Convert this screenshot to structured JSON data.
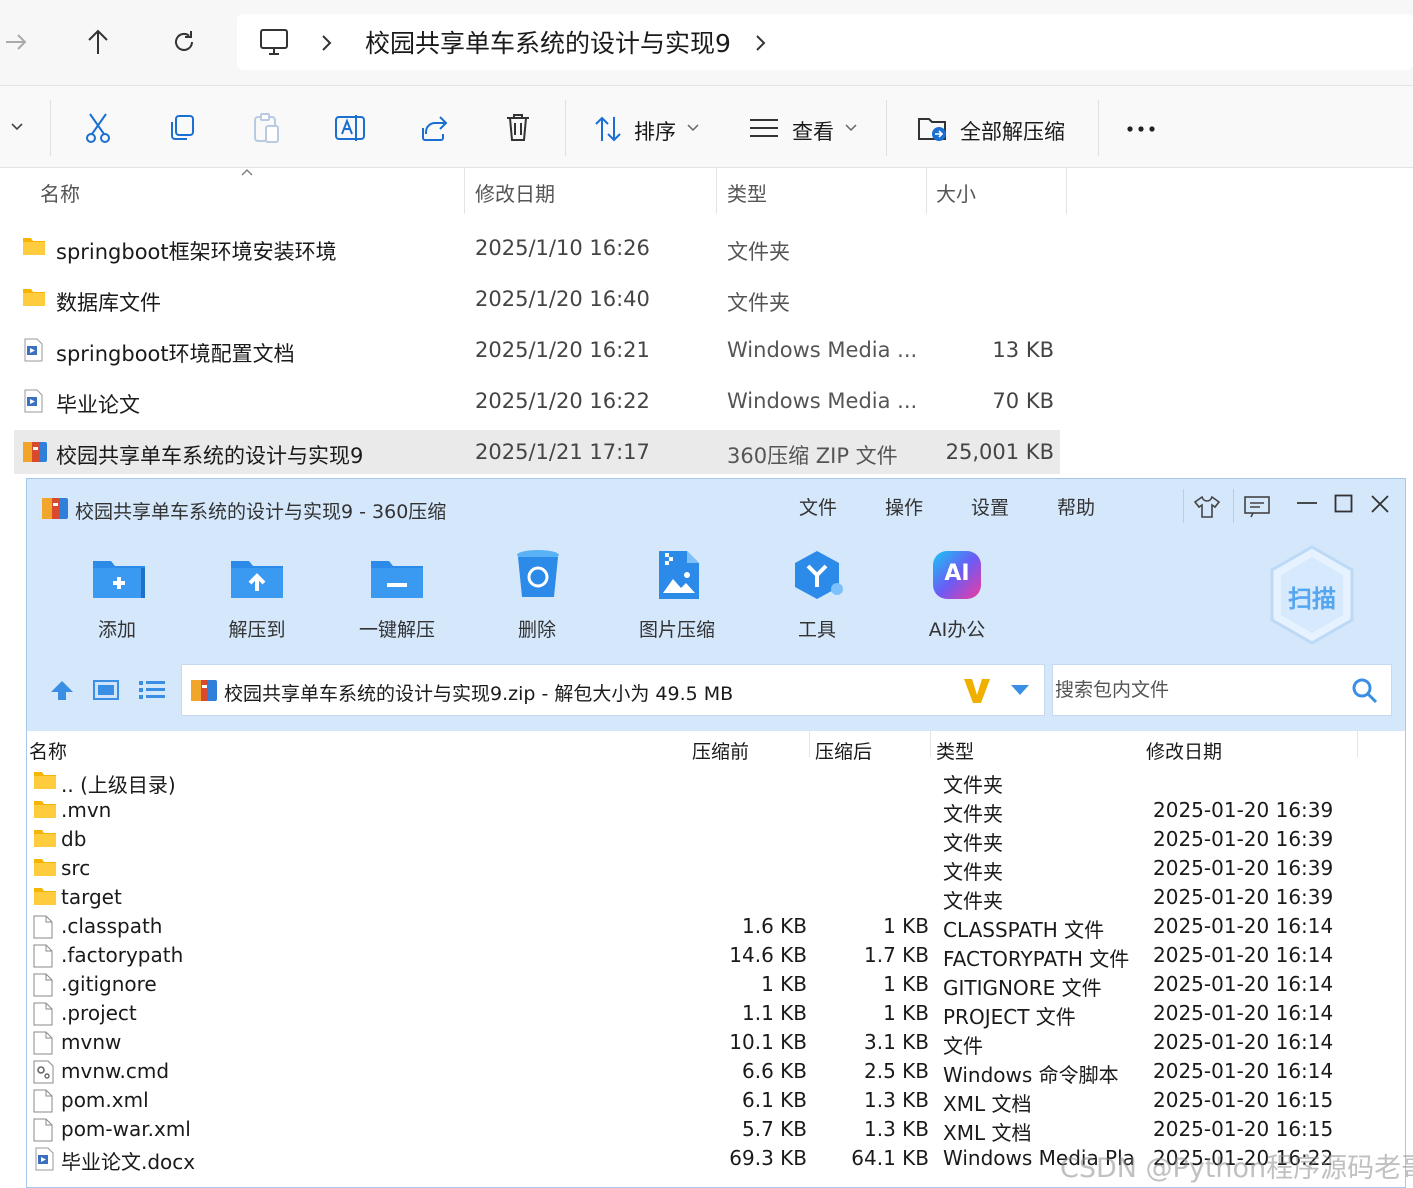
{
  "explorer": {
    "breadcrumb": "校园共享单车系统的设计与实现9",
    "commands": {
      "sort_label": "排序",
      "view_label": "查看",
      "extract_all_label": "全部解压缩"
    },
    "columns": {
      "name": "名称",
      "date": "修改日期",
      "type": "类型",
      "size": "大小"
    },
    "rows": [
      {
        "name": "springboot框架环境安装环境",
        "date": "2025/1/10 16:26",
        "type": "文件夹",
        "size": "",
        "icon": "folder-icon"
      },
      {
        "name": "数据库文件",
        "date": "2025/1/20 16:40",
        "type": "文件夹",
        "size": "",
        "icon": "folder-icon"
      },
      {
        "name": "springboot环境配置文档",
        "date": "2025/1/20 16:21",
        "type": "Windows Media ...",
        "size": "13 KB",
        "icon": "media-file-icon"
      },
      {
        "name": "毕业论文",
        "date": "2025/1/20 16:22",
        "type": "Windows Media ...",
        "size": "70 KB",
        "icon": "media-file-icon"
      },
      {
        "name": "校园共享单车系统的设计与实现9",
        "date": "2025/1/21 17:17",
        "type": "360压缩 ZIP 文件",
        "size": "25,001 KB",
        "icon": "zip-archive-icon",
        "selected": true
      }
    ]
  },
  "zipwin": {
    "title": "校园共享单车系统的设计与实现9 - 360压缩",
    "menu": [
      "文件",
      "操作",
      "设置",
      "帮助"
    ],
    "toolbar": [
      "添加",
      "解压到",
      "一键解压",
      "删除",
      "图片压缩",
      "工具",
      "AI办公"
    ],
    "scan_label": "扫描",
    "ai_badge": "AI",
    "path": "校园共享单车系统的设计与实现9.zip - 解包大小为 49.5 MB",
    "search_placeholder": "搜索包内文件",
    "columns": {
      "name": "名称",
      "before": "压缩前",
      "after": "压缩后",
      "type": "类型",
      "date": "修改日期"
    },
    "rows": [
      {
        "name": ".. (上级目录)",
        "before": "",
        "after": "",
        "type": "文件夹",
        "date": "",
        "icon": "folder-icon"
      },
      {
        "name": ".mvn",
        "before": "",
        "after": "",
        "type": "文件夹",
        "date": "2025-01-20 16:39",
        "icon": "folder-icon"
      },
      {
        "name": "db",
        "before": "",
        "after": "",
        "type": "文件夹",
        "date": "2025-01-20 16:39",
        "icon": "folder-icon"
      },
      {
        "name": "src",
        "before": "",
        "after": "",
        "type": "文件夹",
        "date": "2025-01-20 16:39",
        "icon": "folder-icon"
      },
      {
        "name": "target",
        "before": "",
        "after": "",
        "type": "文件夹",
        "date": "2025-01-20 16:39",
        "icon": "folder-icon"
      },
      {
        "name": ".classpath",
        "before": "1.6 KB",
        "after": "1 KB",
        "type": "CLASSPATH 文件",
        "date": "2025-01-20 16:14",
        "icon": "file-icon"
      },
      {
        "name": ".factorypath",
        "before": "14.6 KB",
        "after": "1.7 KB",
        "type": "FACTORYPATH 文件",
        "date": "2025-01-20 16:14",
        "icon": "file-icon"
      },
      {
        "name": ".gitignore",
        "before": "1 KB",
        "after": "1 KB",
        "type": "GITIGNORE 文件",
        "date": "2025-01-20 16:14",
        "icon": "file-icon"
      },
      {
        "name": ".project",
        "before": "1.1 KB",
        "after": "1 KB",
        "type": "PROJECT 文件",
        "date": "2025-01-20 16:14",
        "icon": "file-icon"
      },
      {
        "name": "mvnw",
        "before": "10.1 KB",
        "after": "3.1 KB",
        "type": "文件",
        "date": "2025-01-20 16:14",
        "icon": "file-icon"
      },
      {
        "name": "mvnw.cmd",
        "before": "6.6 KB",
        "after": "2.5 KB",
        "type": "Windows 命令脚本",
        "date": "2025-01-20 16:14",
        "icon": "cmd-script-icon"
      },
      {
        "name": "pom.xml",
        "before": "6.1 KB",
        "after": "1.3 KB",
        "type": "XML 文档",
        "date": "2025-01-20 16:15",
        "icon": "file-icon"
      },
      {
        "name": "pom-war.xml",
        "before": "5.7 KB",
        "after": "1.3 KB",
        "type": "XML 文档",
        "date": "2025-01-20 16:15",
        "icon": "file-icon"
      },
      {
        "name": "毕业论文.docx",
        "before": "69.3 KB",
        "after": "64.1 KB",
        "type": "Windows Media Pla",
        "date": "2025-01-20 16:22",
        "icon": "media-file-icon"
      }
    ]
  },
  "watermark": "CSDN @Python程序源码老哥"
}
